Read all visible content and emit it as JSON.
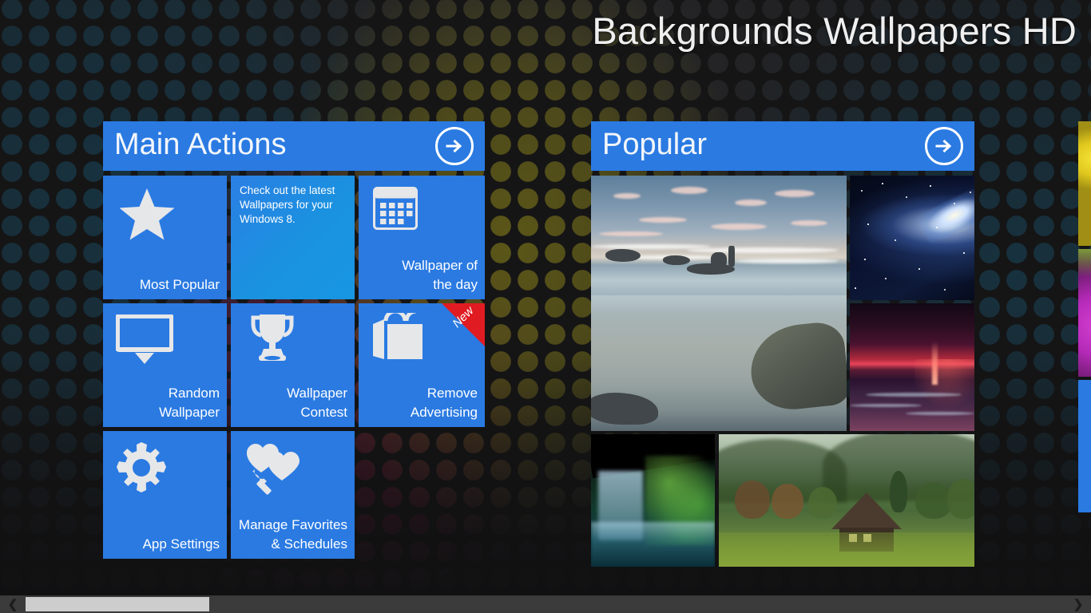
{
  "app": {
    "title": "Backgrounds Wallpapers HD",
    "accent_color": "#2a7ae2",
    "accent_light_color": "#1a92e0",
    "badge_color": "#e01b22",
    "background_color": "#1c1c1e"
  },
  "groups": [
    {
      "id": "main-actions",
      "title": "Main Actions",
      "more_icon": "arrow-right-circle-icon",
      "tiles": [
        {
          "id": "most-popular",
          "label": "Most Popular",
          "icon": "star-icon",
          "style": "solid"
        },
        {
          "id": "latest-wallpapers-promo",
          "body": "Check out the latest\nWallpapers for your\nWindows 8.",
          "icon": "none",
          "style": "light"
        },
        {
          "id": "wallpaper-of-the-day",
          "label": "Wallpaper of\nthe day",
          "icon": "calendar-icon",
          "style": "solid"
        },
        {
          "id": "random-wallpaper",
          "label": "Random\nWallpaper",
          "icon": "monitor-shuffle-icon",
          "style": "solid"
        },
        {
          "id": "wallpaper-contest",
          "label": "Wallpaper\nContest",
          "icon": "trophy-icon",
          "style": "solid"
        },
        {
          "id": "remove-advertising",
          "label": "Remove\nAdvertising",
          "icon": "shopping-bag-icon",
          "style": "solid",
          "badge": "New"
        },
        {
          "id": "app-settings",
          "label": "App Settings",
          "icon": "gear-icon",
          "style": "solid"
        },
        {
          "id": "manage-favorites",
          "label": "Manage Favorites\n& Schedules",
          "icon": "hearts-wrench-icon",
          "style": "solid"
        }
      ]
    },
    {
      "id": "popular",
      "title": "Popular",
      "more_icon": "arrow-right-circle-icon",
      "thumbnails": [
        {
          "id": "beach-sunset-rocks",
          "alt": "Beach with rocks at sunrise"
        },
        {
          "id": "galaxy-stars",
          "alt": "Spiral galaxy in starry sky"
        },
        {
          "id": "red-sunset-ocean",
          "alt": "Red sunset over ocean waves"
        },
        {
          "id": "cave-waterfall",
          "alt": "Waterfall seen from inside a cave"
        },
        {
          "id": "japanese-village",
          "alt": "Thatched roof house in misty valley"
        }
      ]
    },
    {
      "id": "next-group",
      "title": "",
      "thumbnails": [
        {
          "id": "yellow-flower",
          "alt": "Yellow flower close-up"
        },
        {
          "id": "purple-flower",
          "alt": "Purple flower close-up"
        }
      ]
    }
  ],
  "scrollbar": {
    "left_arrow": "❮",
    "right_arrow": "❯"
  }
}
